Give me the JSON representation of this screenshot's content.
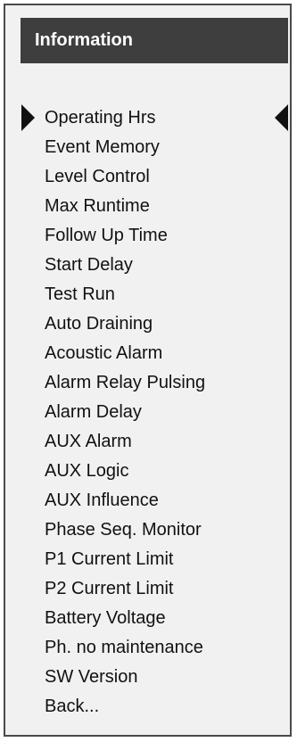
{
  "header": {
    "title": "Information"
  },
  "menu": {
    "selected_index": 0,
    "items": [
      "Operating Hrs",
      "Event Memory",
      "Level Control",
      "Max Runtime",
      "Follow Up Time",
      "Start Delay",
      "Test Run",
      "Auto Draining",
      "Acoustic Alarm",
      "Alarm Relay Pulsing",
      "Alarm Delay",
      "AUX Alarm",
      "AUX Logic",
      "AUX Influence",
      "Phase Seq. Monitor",
      "P1 Current Limit",
      "P2 Current Limit",
      "Battery Voltage",
      "Ph. no maintenance",
      "SW Version",
      "Back..."
    ]
  },
  "icons": {
    "selector_left": "triangle-right-icon",
    "selector_right": "triangle-left-icon"
  },
  "colors": {
    "header_bg": "#3e3e3e",
    "header_text": "#ffffff",
    "panel_bg": "#f1f1f1",
    "text": "#111111"
  }
}
